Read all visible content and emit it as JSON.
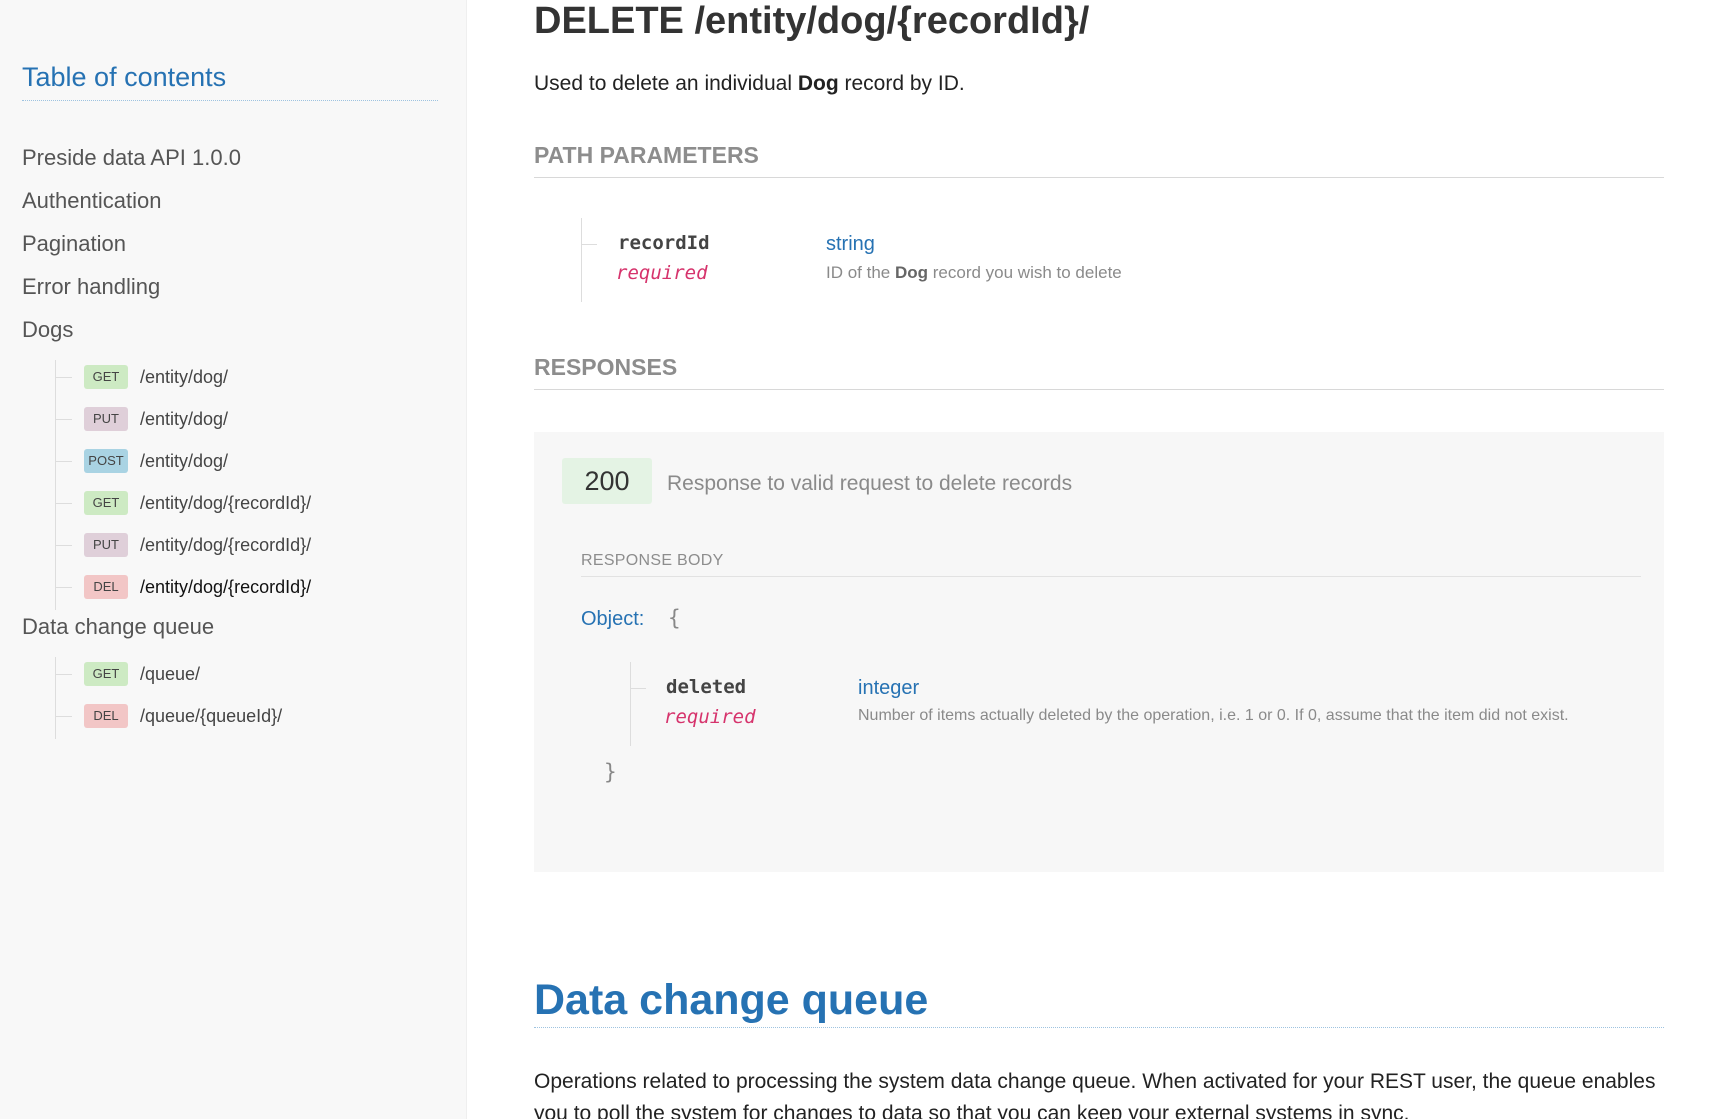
{
  "sidebar": {
    "title": "Table of contents",
    "items": [
      {
        "label": "Preside data API 1.0.0"
      },
      {
        "label": "Authentication"
      },
      {
        "label": "Pagination"
      },
      {
        "label": "Error handling"
      },
      {
        "label": "Dogs"
      },
      {
        "label": "Data change queue"
      }
    ],
    "dogs_endpoints": [
      {
        "method": "GET",
        "path": "/entity/dog/"
      },
      {
        "method": "PUT",
        "path": "/entity/dog/"
      },
      {
        "method": "POST",
        "path": "/entity/dog/"
      },
      {
        "method": "GET",
        "path": "/entity/dog/{recordId}/"
      },
      {
        "method": "PUT",
        "path": "/entity/dog/{recordId}/"
      },
      {
        "method": "DEL",
        "path": "/entity/dog/{recordId}/"
      }
    ],
    "queue_endpoints": [
      {
        "method": "GET",
        "path": "/queue/"
      },
      {
        "method": "DEL",
        "path": "/queue/{queueId}/"
      }
    ]
  },
  "endpoint": {
    "title": "DELETE /entity/dog/{recordId}/",
    "desc_pre": "Used to delete an individual ",
    "desc_bold": "Dog",
    "desc_post": " record by ID."
  },
  "path_params": {
    "heading": "PATH PARAMETERS",
    "name": "recordId",
    "required": "required",
    "type": "string",
    "desc_pre": "ID of the ",
    "desc_bold": "Dog",
    "desc_post": " record you wish to delete"
  },
  "responses": {
    "heading": "RESPONSES",
    "code": "200",
    "code_desc": "Response to valid request to delete records",
    "body_label": "RESPONSE BODY",
    "object_label": "Object:",
    "brace_open": "{",
    "brace_close": "}",
    "field": {
      "name": "deleted",
      "required": "required",
      "type": "integer",
      "desc": "Number of items actually deleted by the operation, i.e. 1 or 0. If 0, assume that the item did not exist."
    }
  },
  "next_section": {
    "title": "Data change queue",
    "desc": "Operations related to processing the system data change queue. When activated for your REST user, the queue enables you to poll the system for changes to data so that you can keep your external systems in sync."
  },
  "colors": {
    "link_blue": "#2672b3",
    "required_pink": "#d6336c",
    "get_badge": "#cdeac3",
    "put_badge": "#dfcfd9",
    "post_badge": "#a9d3e3",
    "del_badge": "#f2c6c6"
  }
}
